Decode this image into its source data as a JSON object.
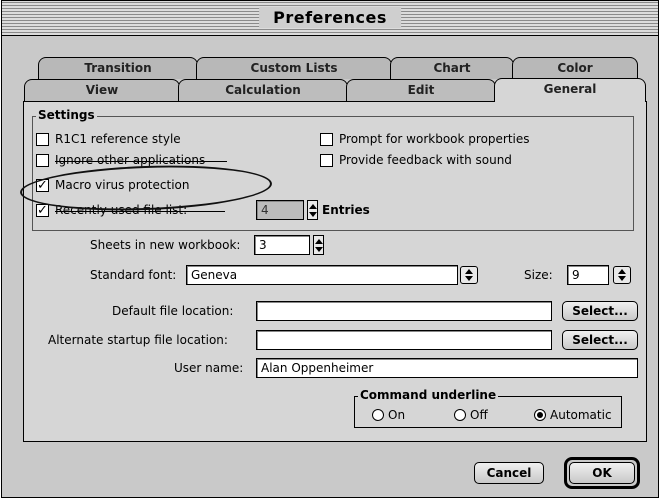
{
  "window": {
    "title": "Preferences"
  },
  "tabs_back": [
    "Transition",
    "Custom Lists",
    "Chart",
    "Color"
  ],
  "tabs_front": [
    "View",
    "Calculation",
    "Edit",
    "General"
  ],
  "settings": {
    "group_label": "Settings",
    "r1c1": {
      "label": "R1C1 reference style",
      "checked": false
    },
    "ignore_other": {
      "label": "Ignore other applications",
      "checked": false
    },
    "macro_virus": {
      "label": "Macro virus protection",
      "checked": true
    },
    "recent_files": {
      "label": "Recently used file list:",
      "checked": true,
      "count": "4",
      "suffix": "Entries"
    },
    "prompt_props": {
      "label": "Prompt for workbook properties",
      "checked": false
    },
    "feedback_sound": {
      "label": "Provide feedback with sound",
      "checked": false
    }
  },
  "sheets": {
    "label": "Sheets in new workbook:",
    "value": "3"
  },
  "font": {
    "label": "Standard font:",
    "value": "Geneva",
    "size_label": "Size:",
    "size_value": "9"
  },
  "default_location": {
    "label": "Default file location:",
    "value": "",
    "button": "Select..."
  },
  "alt_startup": {
    "label": "Alternate startup file location:",
    "value": "",
    "button": "Select..."
  },
  "user_name": {
    "label": "User name:",
    "value": "Alan Oppenheimer"
  },
  "command_underline": {
    "label": "Command underline",
    "options": [
      "On",
      "Off",
      "Automatic"
    ],
    "selected": "Automatic"
  },
  "buttons": {
    "cancel": "Cancel",
    "ok": "OK"
  }
}
